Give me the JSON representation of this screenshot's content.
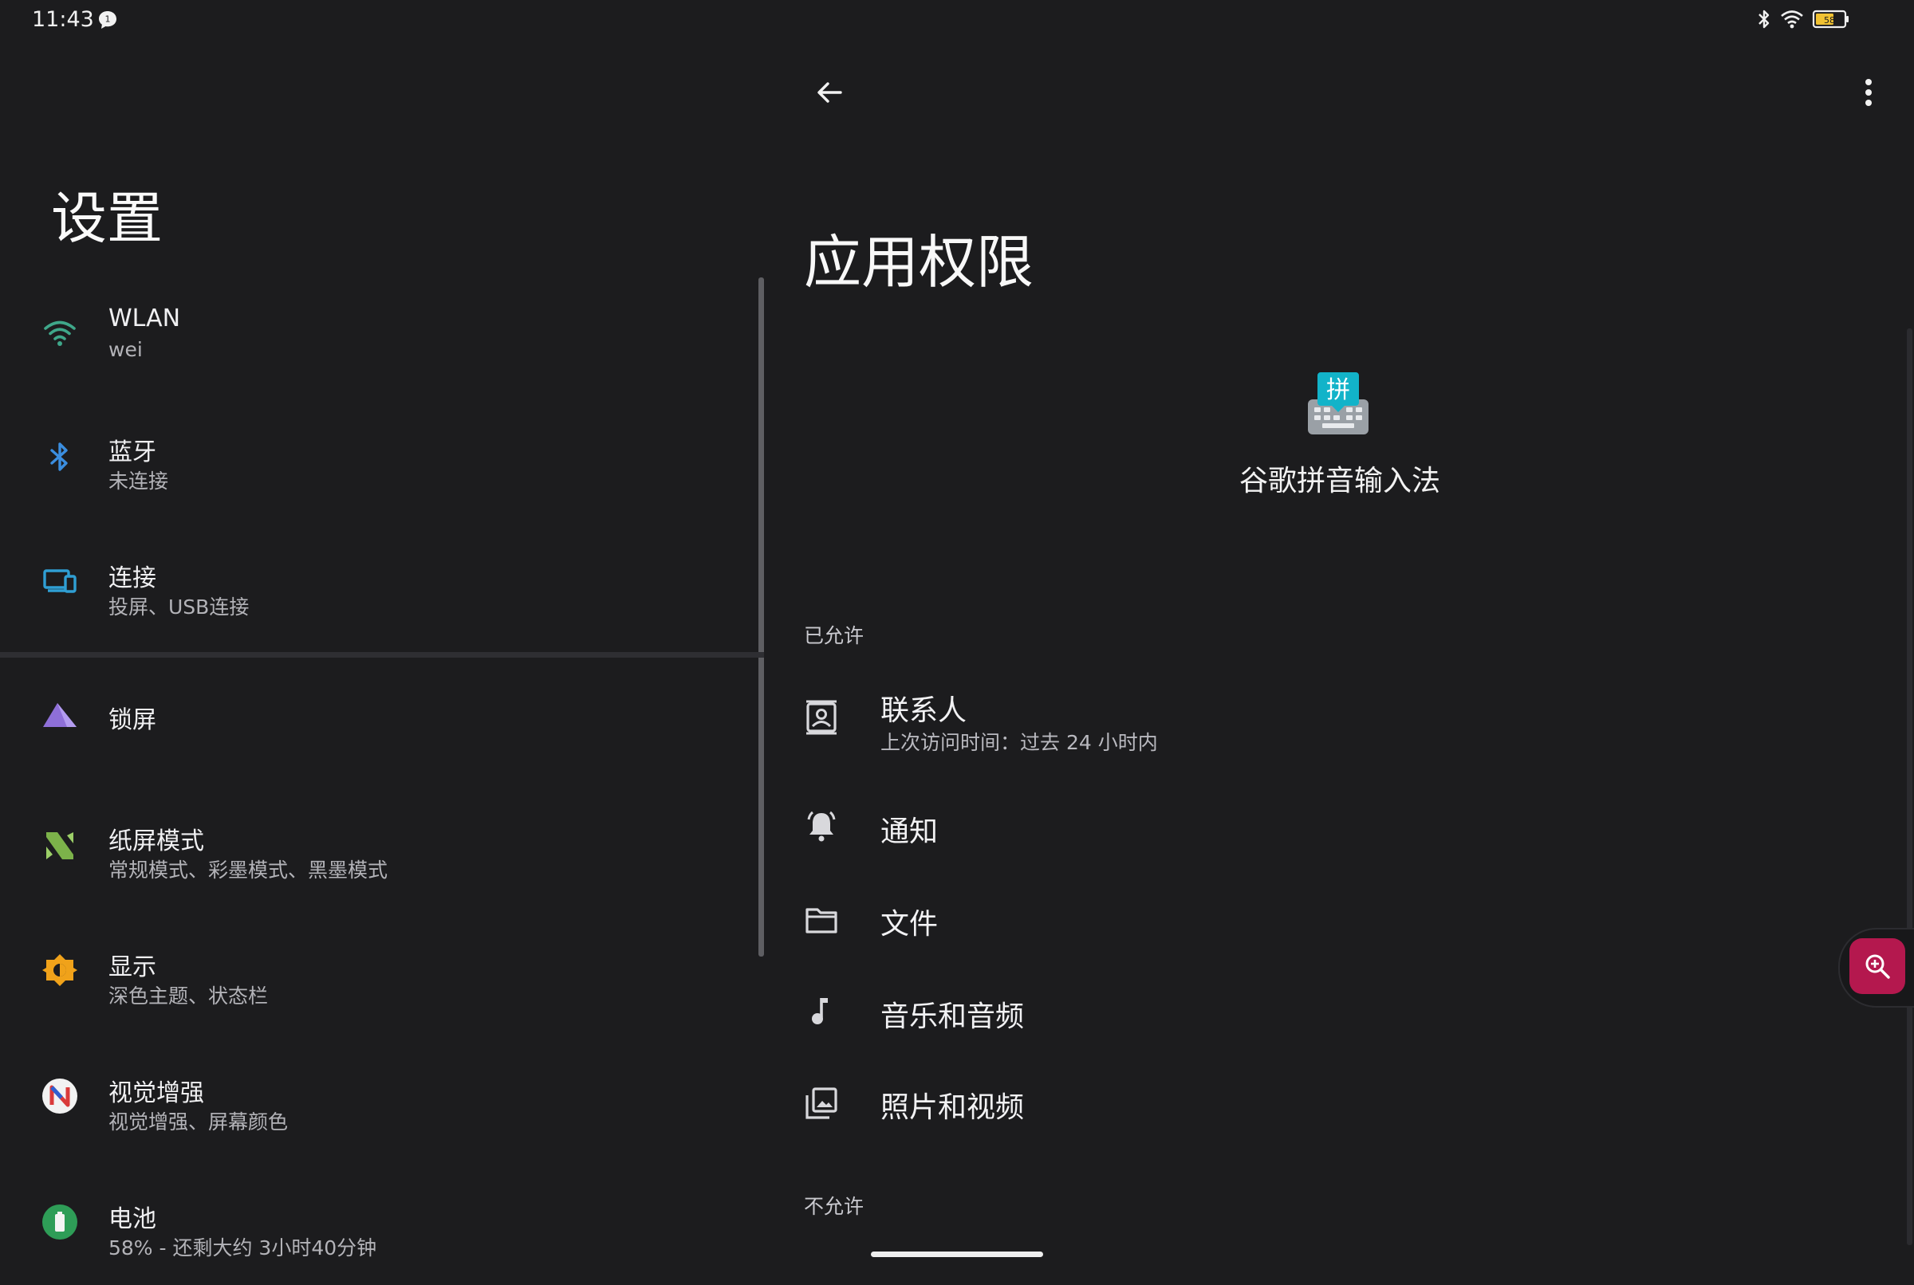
{
  "status_bar": {
    "time": "11:43",
    "notification_icon": "chat-bubble-icon",
    "icons": [
      "bluetooth-icon",
      "wifi-icon",
      "battery-icon"
    ]
  },
  "settings_pane": {
    "title": "设置",
    "items": [
      {
        "title": "WLAN",
        "subtitle": "wei",
        "icon": "wifi-icon",
        "color": "#3fa78a"
      },
      {
        "title": "蓝牙",
        "subtitle": "未连接",
        "icon": "bluetooth-icon",
        "color": "#3b8ee0"
      },
      {
        "title": "连接",
        "subtitle": "投屏、USB连接",
        "icon": "devices-icon",
        "color": "#2f9fd4"
      },
      {
        "title": "锁屏",
        "subtitle": "",
        "icon": "lockscreen-icon",
        "color": "#8e6fd8"
      },
      {
        "title": "纸屏模式",
        "subtitle": "常规模式、彩墨模式、黑墨模式",
        "icon": "paper-mode-icon",
        "color": "#7cb24a"
      },
      {
        "title": "显示",
        "subtitle": "深色主题、状态栏",
        "icon": "brightness-icon",
        "color": "#f0a21a"
      },
      {
        "title": "视觉增强",
        "subtitle": "视觉增强、屏幕颜色",
        "icon": "vision-enhance-icon",
        "color": "#d93a3a"
      },
      {
        "title": "电池",
        "subtitle": "58% - 还剩大约 3小时40分钟",
        "icon": "battery-icon",
        "color": "#2e9d57"
      }
    ]
  },
  "permissions_pane": {
    "title": "应用权限",
    "app": {
      "name": "谷歌拼音输入法",
      "icon": "pinyin-keyboard-icon",
      "icon_char": "拼"
    },
    "allowed_header": "已允许",
    "allowed": [
      {
        "title": "联系人",
        "subtitle": "上次访问时间：过去 24 小时内",
        "icon": "contacts-icon"
      },
      {
        "title": "通知",
        "subtitle": "",
        "icon": "notification-bell-icon"
      },
      {
        "title": "文件",
        "subtitle": "",
        "icon": "folder-icon"
      },
      {
        "title": "音乐和音频",
        "subtitle": "",
        "icon": "music-note-icon"
      },
      {
        "title": "照片和视频",
        "subtitle": "",
        "icon": "photo-library-icon"
      }
    ],
    "denied_header": "不允许"
  },
  "floating_button": {
    "icon": "zoom-in-icon",
    "color": "#b4184e"
  },
  "colors": {
    "background": "#1c1c1e",
    "text_primary": "#f0f0f2",
    "text_secondary": "#b3b3b8"
  }
}
